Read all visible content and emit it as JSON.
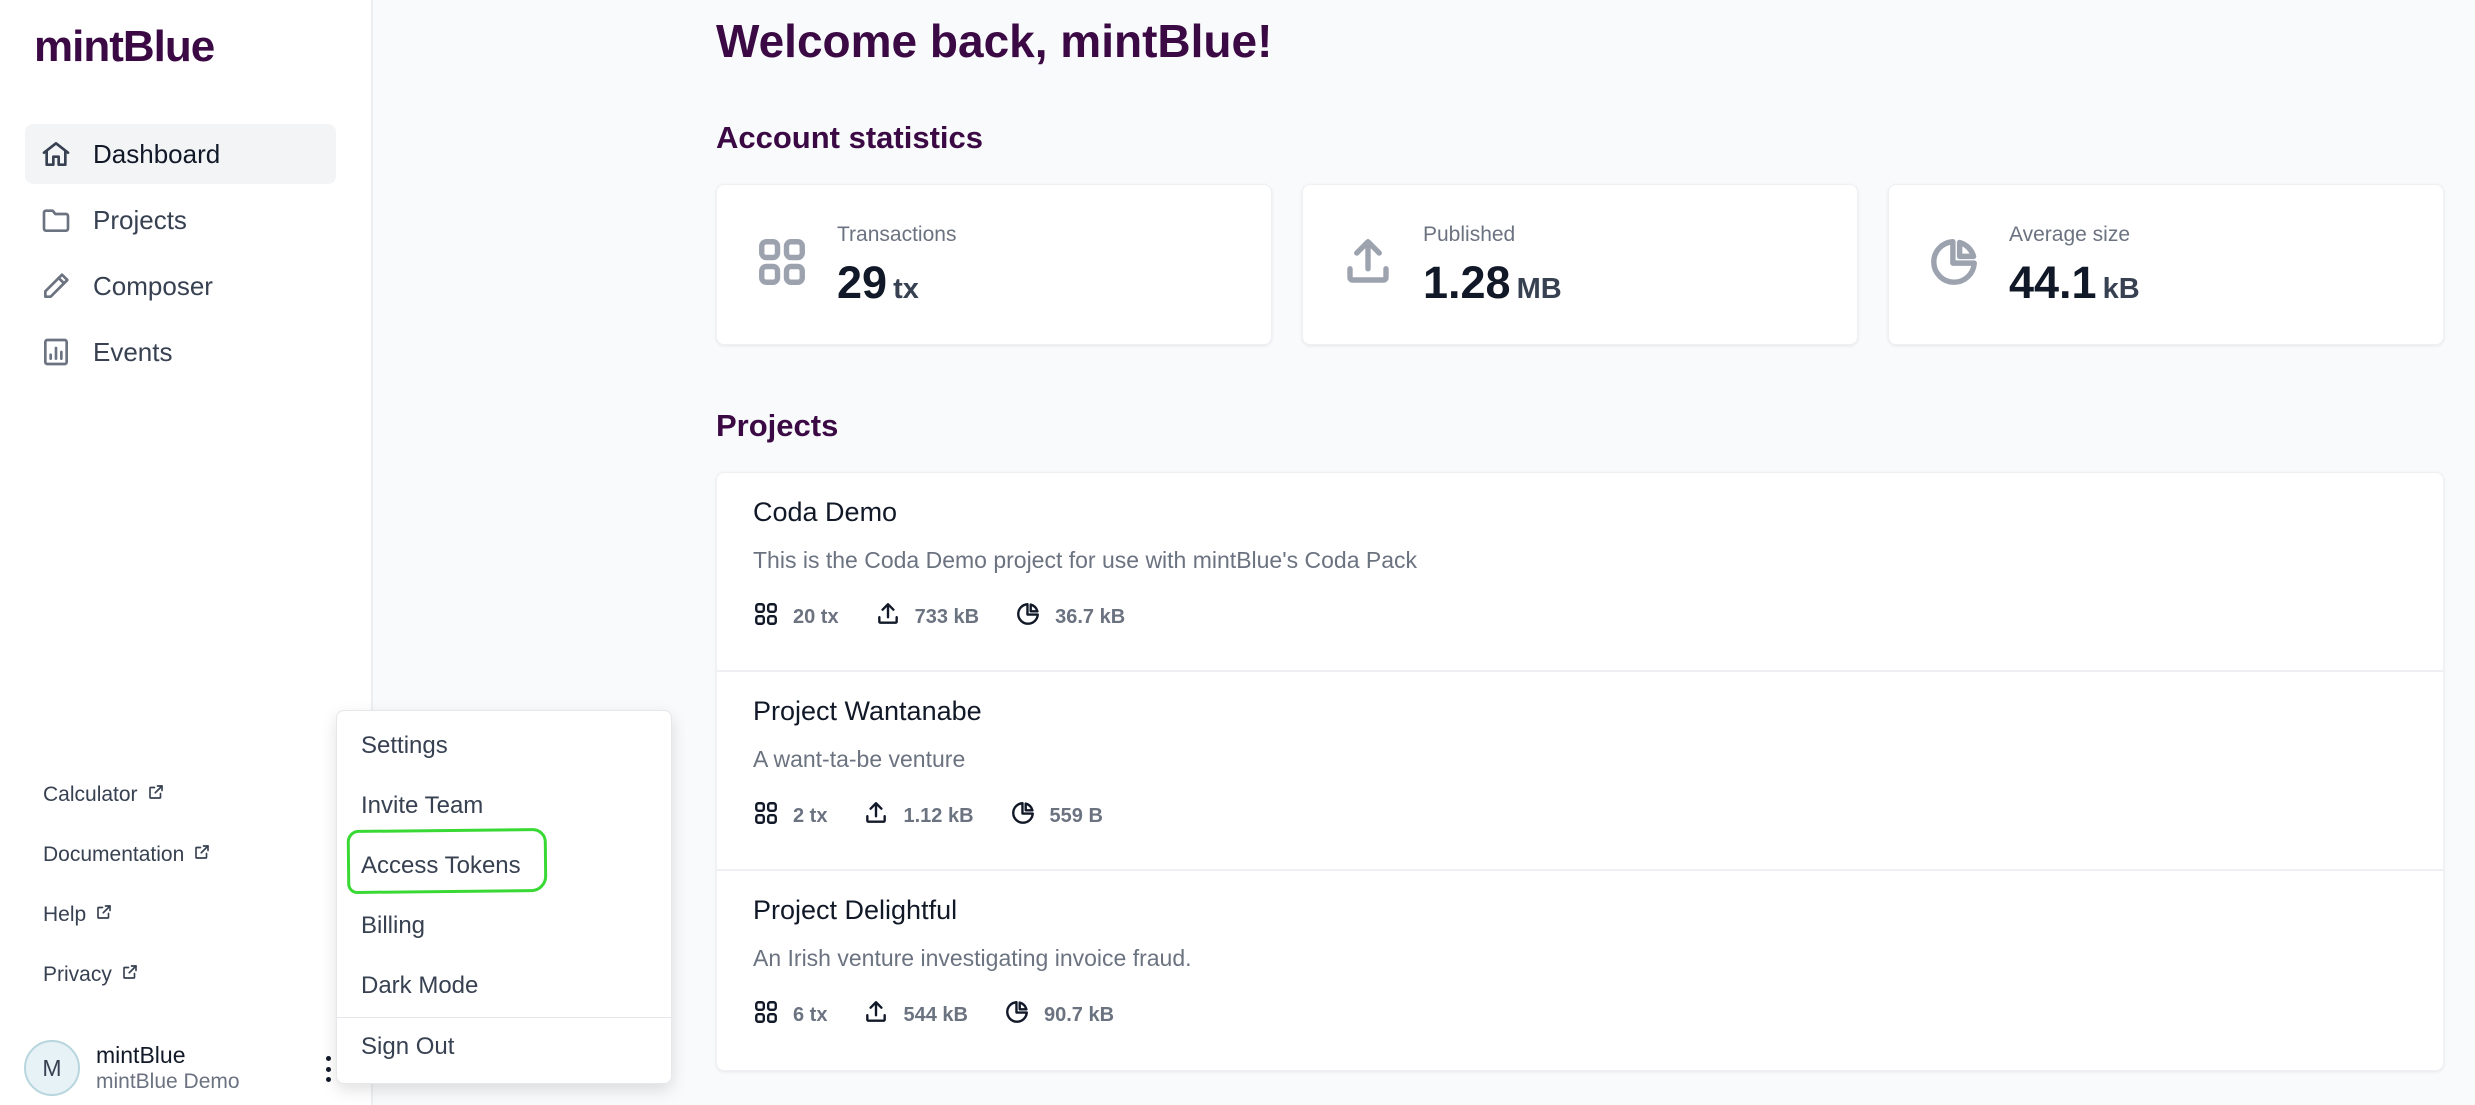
{
  "app": {
    "logo": "mintBlue"
  },
  "sidebar": {
    "nav": [
      {
        "label": "Dashboard",
        "icon": "home-icon",
        "active": true
      },
      {
        "label": "Projects",
        "icon": "folder-icon"
      },
      {
        "label": "Composer",
        "icon": "pencil-icon"
      },
      {
        "label": "Events",
        "icon": "chart-icon"
      }
    ],
    "links": [
      {
        "label": "Calculator",
        "icon": "external-link-icon"
      },
      {
        "label": "Documentation",
        "icon": "external-link-icon"
      },
      {
        "label": "Help",
        "icon": "external-link-icon"
      },
      {
        "label": "Privacy",
        "icon": "external-link-icon"
      }
    ],
    "user": {
      "initial": "M",
      "name": "mintBlue",
      "org": "mintBlue Demo"
    }
  },
  "menu": {
    "items": [
      "Settings",
      "Invite Team",
      "Access Tokens",
      "Billing",
      "Dark Mode"
    ],
    "signout": "Sign Out",
    "highlight_color": "#39d935"
  },
  "main": {
    "welcome": "Welcome back, mintBlue!",
    "stats_title": "Account statistics",
    "stats": [
      {
        "label": "Transactions",
        "value": "29",
        "unit": "tx",
        "icon": "grid-icon"
      },
      {
        "label": "Published",
        "value": "1.28",
        "unit": "MB",
        "icon": "upload-icon"
      },
      {
        "label": "Average size",
        "value": "44.1",
        "unit": "kB",
        "icon": "pie-chart-icon"
      }
    ],
    "projects_title": "Projects",
    "projects": [
      {
        "name": "Coda Demo",
        "description": "This is the Coda Demo project for use with mintBlue's Coda Pack",
        "tx": "20 tx",
        "size": "733 kB",
        "avg": "36.7 kB"
      },
      {
        "name": "Project Wantanabe",
        "description": "A want-ta-be venture",
        "tx": "2 tx",
        "size": "1.12 kB",
        "avg": "559 B"
      },
      {
        "name": "Project Delightful",
        "description": "An Irish venture investigating invoice fraud.",
        "tx": "6 tx",
        "size": "544 kB",
        "avg": "90.7 kB"
      }
    ]
  },
  "colors": {
    "brand": "#3b0a45",
    "background": "#f9fafb"
  }
}
